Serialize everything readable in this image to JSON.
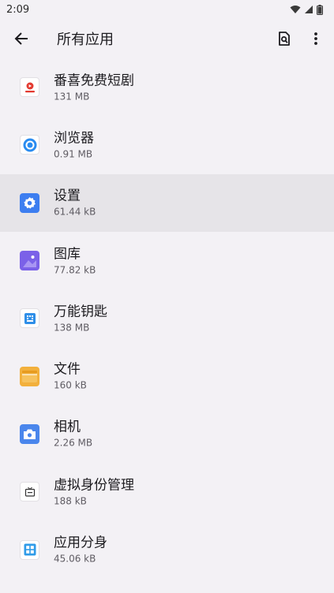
{
  "status_bar": {
    "time": "2:09"
  },
  "app_bar": {
    "title": "所有应用"
  },
  "apps": [
    {
      "name": "番喜免费短剧",
      "size": "131 MB",
      "icon": "play-red-icon"
    },
    {
      "name": "浏览器",
      "size": "0.91 MB",
      "icon": "browser-icon"
    },
    {
      "name": "设置",
      "size": "61.44 kB",
      "icon": "gear-icon"
    },
    {
      "name": "图库",
      "size": "77.82 kB",
      "icon": "gallery-icon"
    },
    {
      "name": "万能钥匙",
      "size": "138 MB",
      "icon": "wifi-key-icon"
    },
    {
      "name": "文件",
      "size": "160 kB",
      "icon": "folder-icon"
    },
    {
      "name": "相机",
      "size": "2.26 MB",
      "icon": "camera-icon"
    },
    {
      "name": "虚拟身份管理",
      "size": "188 kB",
      "icon": "tv-icon"
    },
    {
      "name": "应用分身",
      "size": "45.06 kB",
      "icon": "grid-icon"
    }
  ],
  "colors": {
    "background": "#f3f1f5",
    "selected_row": "#e6e4e8",
    "settings_blue": "#3d7ef0",
    "gallery_purple": "#7b61e8",
    "files_yellow": "#f2b03c",
    "camera_blue": "#4a86ec",
    "browser_blue": "#2a8cf0"
  }
}
